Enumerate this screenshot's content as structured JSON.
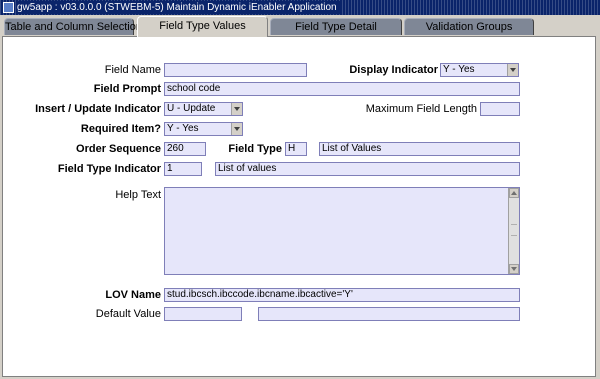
{
  "window": {
    "title": "gw5app : v03.0.0.0  (STWEBM-5) Maintain Dynamic iEnabler Application"
  },
  "tabs": [
    {
      "label": "Table and Column Selection"
    },
    {
      "label": "Field Type Values"
    },
    {
      "label": "Field Type Detail"
    },
    {
      "label": "Validation Groups"
    }
  ],
  "form": {
    "field_name": {
      "label": "Field Name",
      "value": ""
    },
    "display_indicator": {
      "label": "Display Indicator",
      "value": "Y - Yes"
    },
    "field_prompt": {
      "label": "Field Prompt",
      "value": "school code"
    },
    "insert_update_indicator": {
      "label": "Insert / Update Indicator",
      "value": "U - Update"
    },
    "maximum_field_length": {
      "label": "Maximum Field Length",
      "value": ""
    },
    "required_item": {
      "label": "Required Item?",
      "value": "Y - Yes"
    },
    "order_sequence": {
      "label": "Order Sequence",
      "value": "260"
    },
    "field_type": {
      "label": "Field Type",
      "code": "H",
      "description": "List of Values"
    },
    "field_type_indicator": {
      "label": "Field Type Indicator",
      "code": "1",
      "description": "List of values"
    },
    "help_text": {
      "label": "Help Text",
      "value": ""
    },
    "lov_name": {
      "label": "LOV Name",
      "value": "stud.ibcsch.ibccode.ibcname.ibcactive='Y'"
    },
    "default_value": {
      "label": "Default Value",
      "value": "",
      "description": ""
    }
  },
  "colors": {
    "field_bg": "#e6e6fa",
    "title_bg": "#0a246a",
    "tab_inactive": "#7f8796"
  }
}
